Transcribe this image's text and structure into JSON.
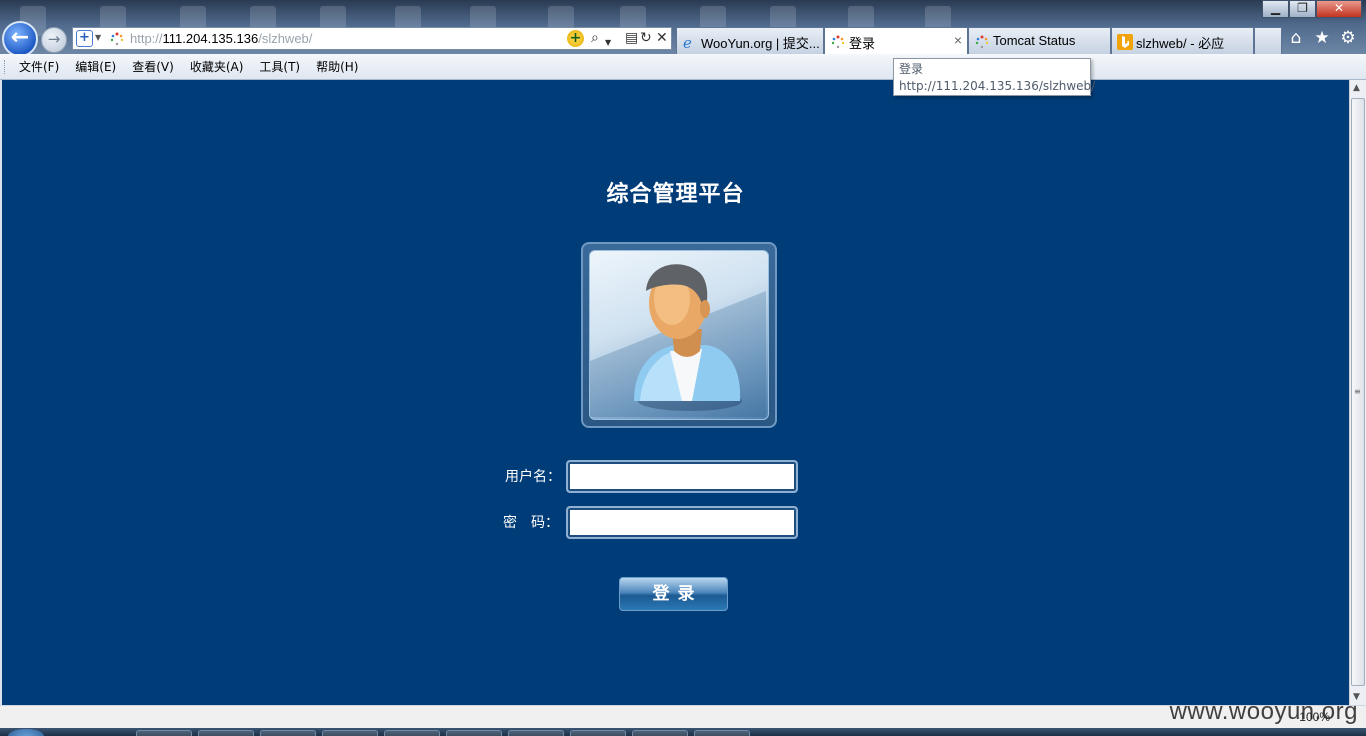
{
  "browser": {
    "address": {
      "url_prefix": "http://",
      "url_host": "111.204.135.136",
      "url_path": "/slzhweb/"
    },
    "tabs": [
      {
        "label": "WooYun.org | 提交...",
        "icon": "ie-icon",
        "active": false
      },
      {
        "label": "登录",
        "icon": "loading-icon",
        "active": true
      },
      {
        "label": "Tomcat Status",
        "icon": "loading-icon",
        "active": false
      },
      {
        "label": "slzhweb/ - 必应",
        "icon": "bing-icon",
        "active": false
      }
    ],
    "tab_close_glyph": "×",
    "toolbar_icons": [
      "home-icon",
      "favorites-star-icon",
      "gear-icon"
    ],
    "window_controls": {
      "minimize": "▁",
      "maximize": "❐",
      "close": "✕"
    }
  },
  "menu": {
    "items": [
      "文件(F)",
      "编辑(E)",
      "查看(V)",
      "收藏夹(A)",
      "工具(T)",
      "帮助(H)"
    ]
  },
  "tooltip": {
    "title": "登录",
    "url": "http://111.204.135.136/slzhweb/"
  },
  "page": {
    "title": "综合管理平台",
    "username_label": "用户名：",
    "password_label": "密　码：",
    "username_value": "",
    "password_value": "",
    "login_button": "登录",
    "background_color": "#003c78"
  },
  "status_bar": {
    "zoom": "100%",
    "watermark": "www.wooyun.org"
  }
}
